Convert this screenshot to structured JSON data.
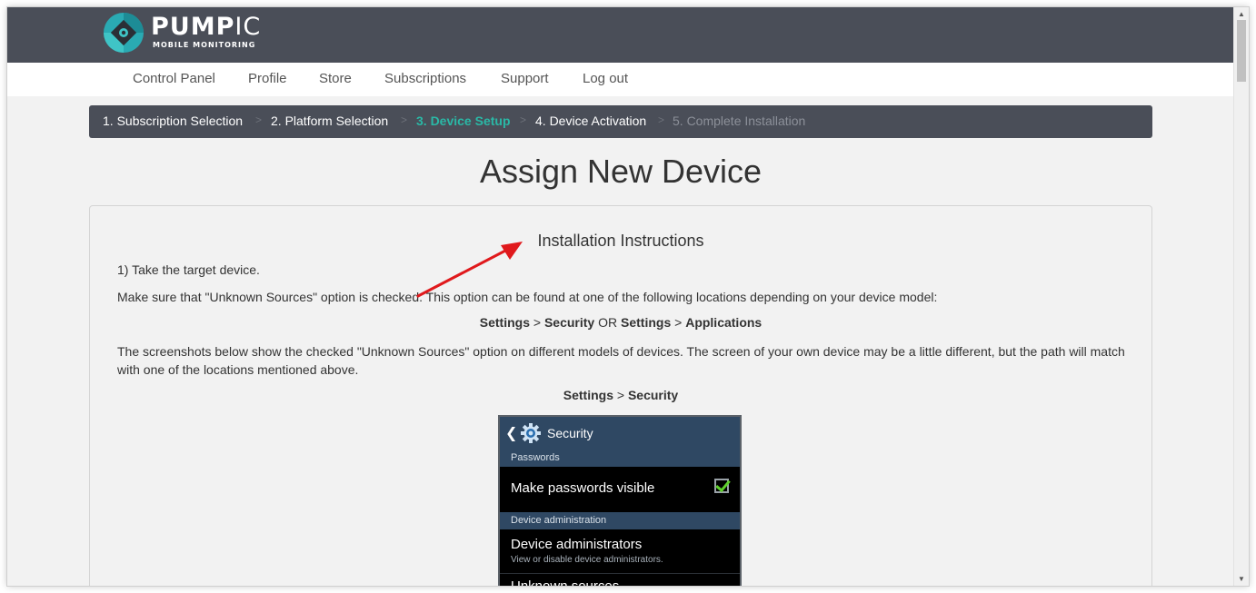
{
  "header": {
    "brand_name_bold": "PUMP",
    "brand_name_thin": "IC",
    "brand_tagline": "MOBILE MONITORING"
  },
  "nav": {
    "items": [
      {
        "label": "Control Panel"
      },
      {
        "label": "Profile"
      },
      {
        "label": "Store"
      },
      {
        "label": "Subscriptions"
      },
      {
        "label": "Support"
      },
      {
        "label": "Log out"
      }
    ]
  },
  "steps": {
    "separator": ">",
    "items": [
      {
        "label": "1. Subscription Selection",
        "state": "done"
      },
      {
        "label": "2. Platform Selection",
        "state": "done"
      },
      {
        "label": "3. Device Setup",
        "state": "active"
      },
      {
        "label": "4. Device Activation",
        "state": "done"
      },
      {
        "label": "5. Complete Installation",
        "state": "pending"
      }
    ]
  },
  "page": {
    "title": "Assign New Device"
  },
  "instructions": {
    "title": "Installation Instructions",
    "step1": "1) Take the target device.",
    "make_sure": "Make sure that \"Unknown Sources\" option is checked. This option can be found at one of the following locations depending on your device model:",
    "path_line": {
      "p1": "Settings",
      "sep1": " > ",
      "p2": "Security",
      "or": " OR ",
      "p3": "Settings",
      "sep2": " > ",
      "p4": "Applications"
    },
    "screenshots_note": "The screenshots below show the checked \"Unknown Sources\" option on different models of devices. The screen of your own device may be a little different, but the path will match with one of the locations mentioned above.",
    "caption": {
      "p1": "Settings",
      "sep": " > ",
      "p2": "Security"
    }
  },
  "phone": {
    "title": "Security",
    "section_passwords": "Passwords",
    "make_passwords_visible": "Make passwords visible",
    "make_passwords_checked": true,
    "section_device_admin": "Device administration",
    "device_administrators": "Device administrators",
    "device_administrators_sub": "View or disable device administrators.",
    "unknown_sources": "Unknown sources"
  },
  "colors": {
    "header_bg": "#4a4e58",
    "accent": "#2ab8a6",
    "arrow": "#e0191c",
    "phone_bar": "#2f4863"
  },
  "icons": {
    "logo": "pumpic-logo-icon",
    "arrow": "red-arrow-annotation",
    "gear": "gear-icon",
    "back": "back-chevron-icon",
    "check": "checkbox-checked-icon"
  }
}
